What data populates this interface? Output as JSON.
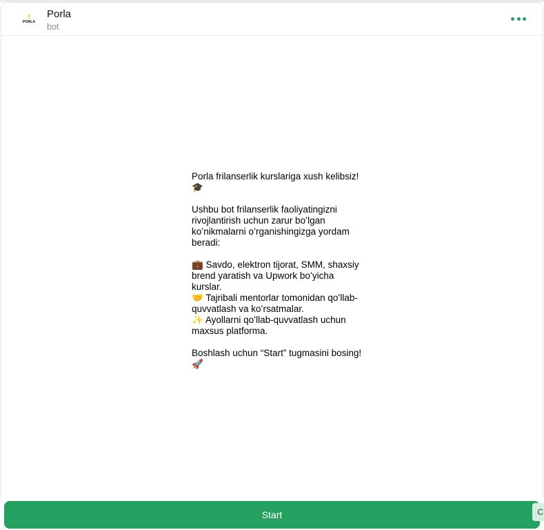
{
  "header": {
    "title": "Porla",
    "subtitle": "bot",
    "avatar_text": "PORLA"
  },
  "message": {
    "text": "Porla frilanserlik kurslariga xush kelibsiz! 🎓\n\nUshbu bot frilanserlik faoliyatingizni rivojlantirish uchun zarur boʻlgan koʻnikmalarni oʻrganishingizga yordam beradi:\n\n💼 Savdo, elektron tijorat, SMM, shaxsiy brend yaratish va Upwork boʻyicha kurslar.\n🤝 Tajribali mentorlar tomonidan qoʻllab-quvvatlash va koʻrsatmalar.\n✨ Ayollarni qoʻllab-quvvatlash uchun maxsus platforma.\n\nBoshlash uchun “Start” tugmasini bosing! 🚀"
  },
  "bottom": {
    "start_label": "Start",
    "side_chip_label": "C"
  },
  "colors": {
    "accent": "#24a061",
    "menu_dots": "#2b9a64"
  },
  "icons": {
    "avatar": "porla-logo-icon",
    "menu": "more-dots-icon"
  }
}
